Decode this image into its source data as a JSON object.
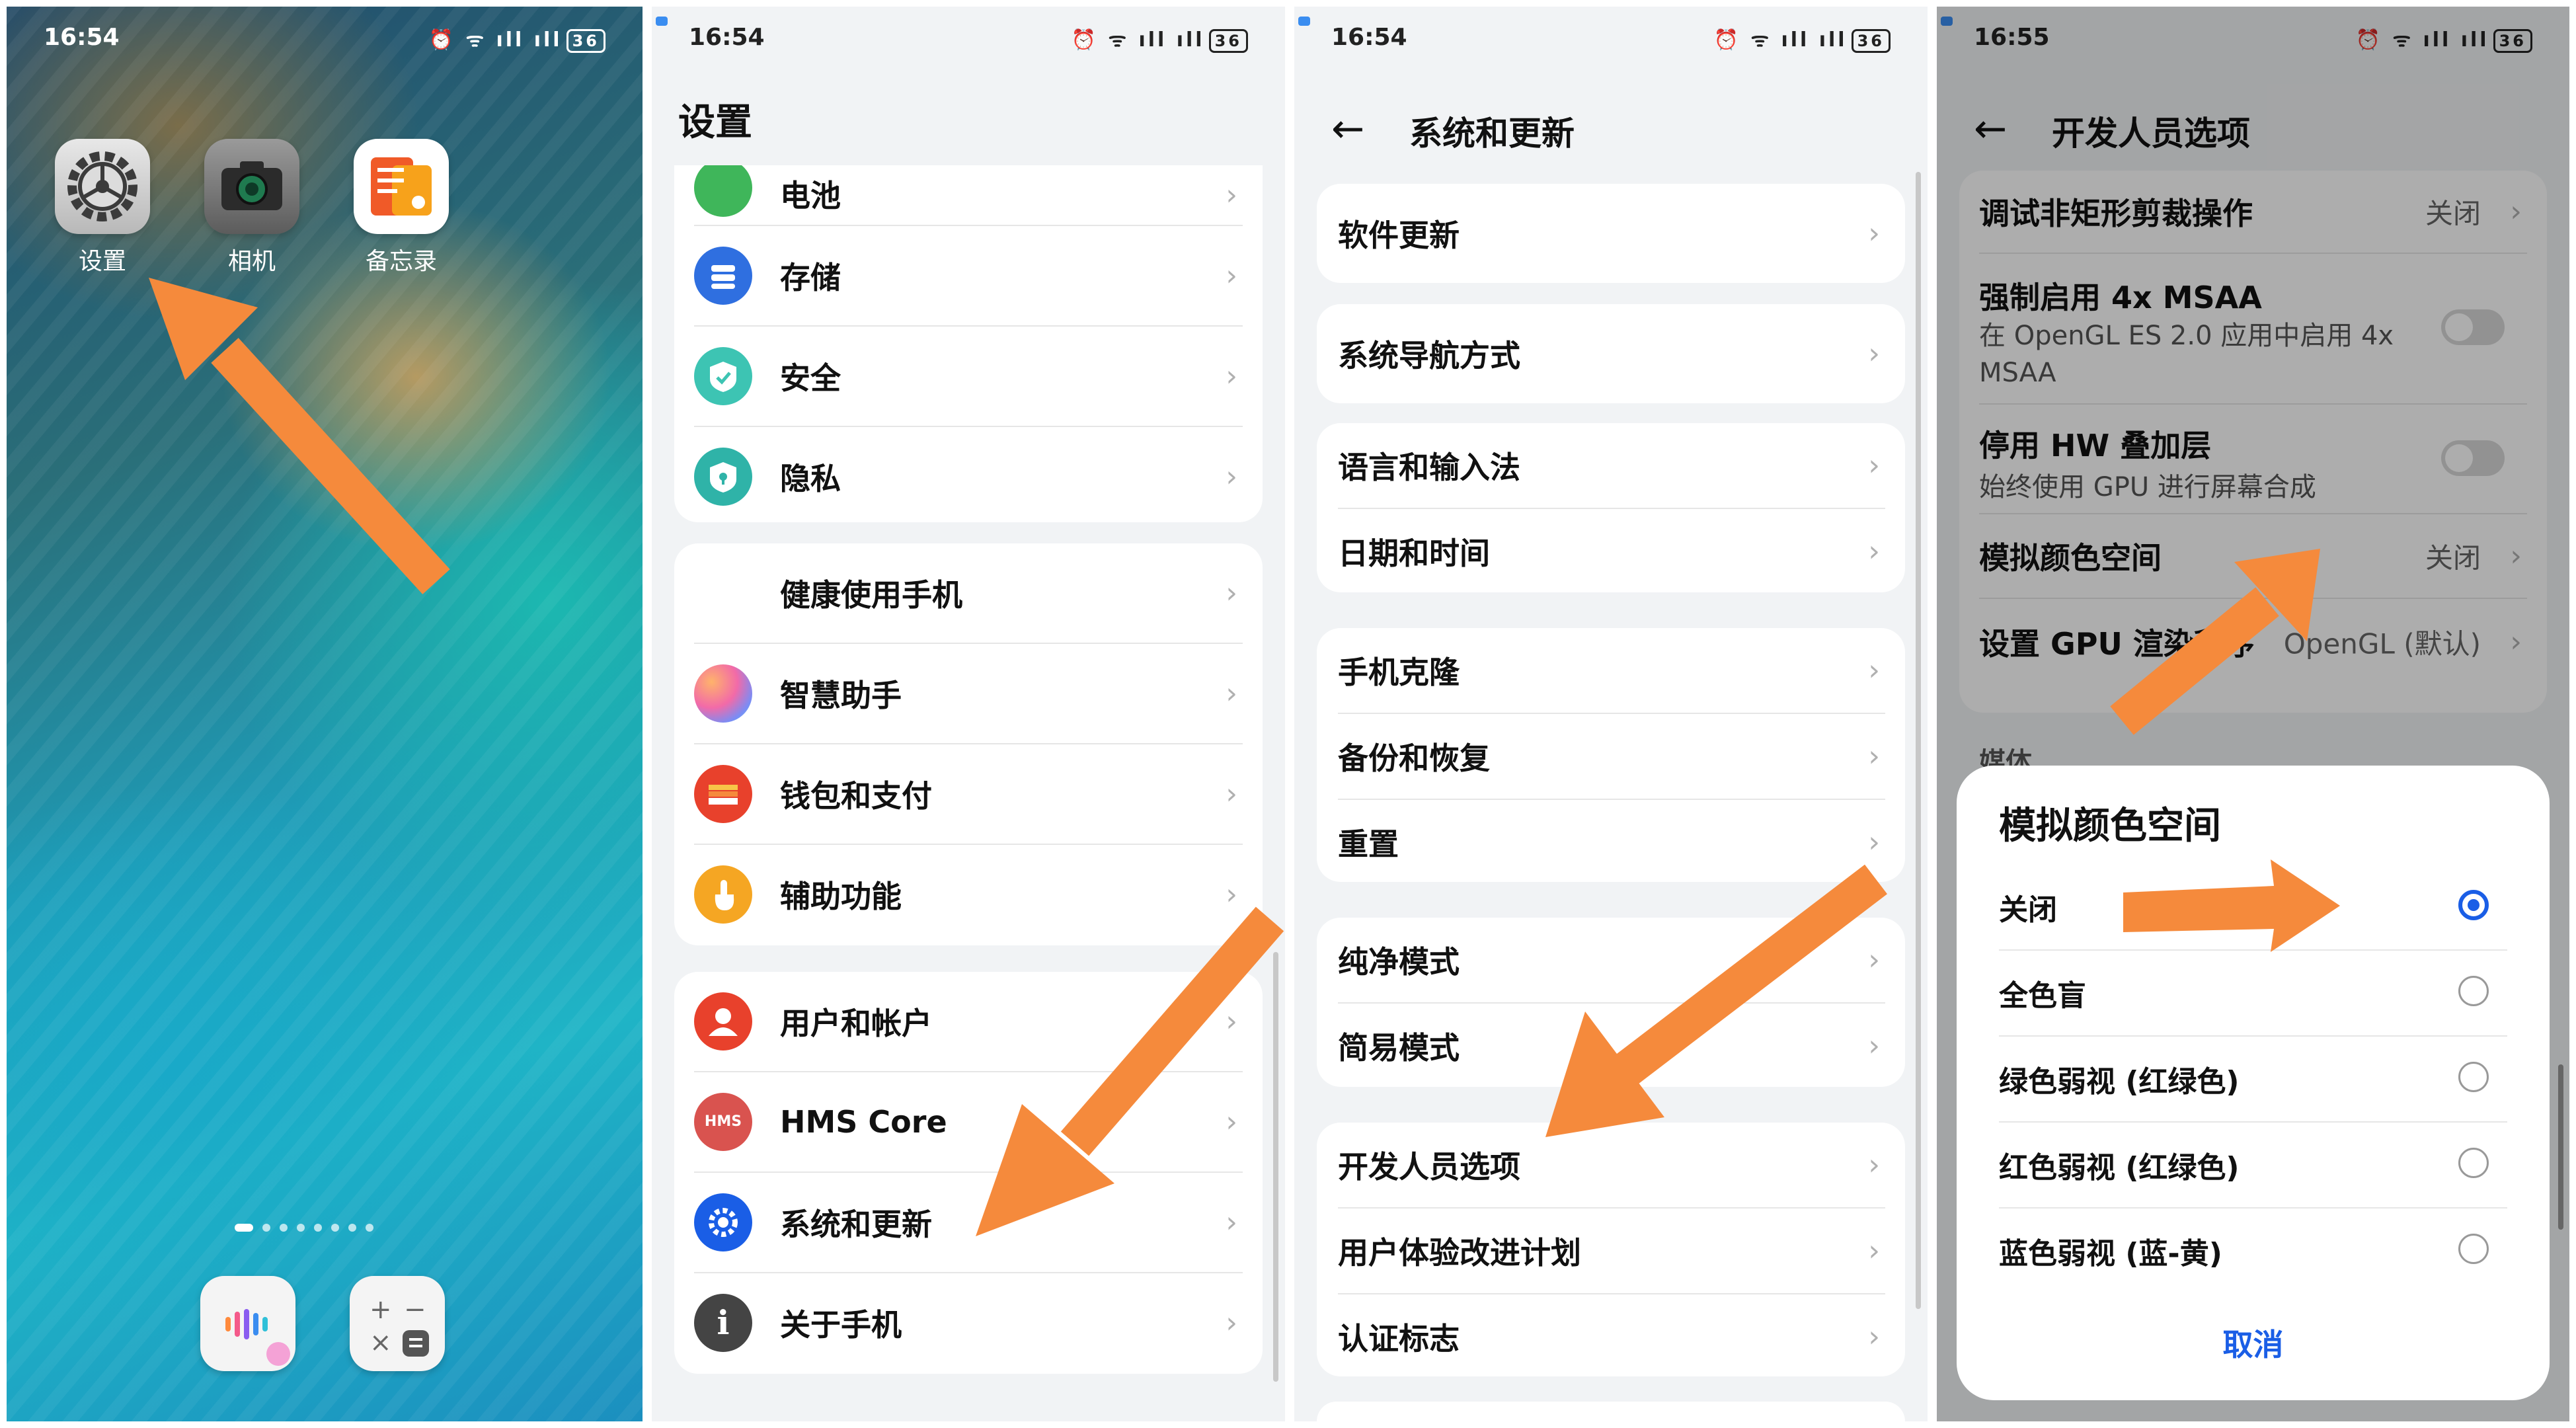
{
  "p1": {
    "time": "16:54",
    "status_icons": "⏰ ᯤ ıll ıll",
    "battery": "36",
    "apps": [
      {
        "label": "设置",
        "icon": "settings-gear-icon"
      },
      {
        "label": "相机",
        "icon": "camera-icon"
      },
      {
        "label": "备忘录",
        "icon": "notes-icon"
      }
    ],
    "dock": [
      {
        "icon": "voice-assistant-icon"
      },
      {
        "icon": "calculator-icon",
        "glyph": "+ −\n× ="
      }
    ]
  },
  "p2": {
    "time": "16:54",
    "status_icons": "⏰ ᯤ ıll ıll",
    "battery": "36",
    "title": "设置",
    "partial_item": "电池",
    "group1": [
      "存储",
      "安全",
      "隐私"
    ],
    "group2": [
      "健康使用手机",
      "智慧助手",
      "钱包和支付",
      "辅助功能"
    ],
    "group3": [
      "用户和帐户",
      "HMS Core",
      "系统和更新",
      "关于手机"
    ],
    "icon_glyphs": {
      "hms": "HMS",
      "about": "i"
    },
    "icon_colors": [
      "#2f6fe0",
      "#1fb6a6",
      "#27b0a0",
      "#2ab34a",
      "#ff8a5c",
      "#e8412c",
      "#f5a623",
      "#e8412c",
      "#d9534f",
      "#1a5ee6",
      "#444444"
    ]
  },
  "p3": {
    "time": "16:54",
    "status_icons": "⏰ ᯤ ıll ıll",
    "battery": "36",
    "title": "系统和更新",
    "items": [
      "软件更新",
      "系统导航方式",
      "语言和输入法",
      "日期和时间",
      "手机克隆",
      "备份和恢复",
      "重置",
      "纯净模式",
      "简易模式",
      "开发人员选项",
      "用户体验改进计划",
      "认证标志"
    ]
  },
  "p4": {
    "time": "16:55",
    "status_icons": "⏰ ᯤ ıll ıll",
    "battery": "36",
    "title": "开发人员选项",
    "settings": {
      "debug_clip": {
        "label": "调试非矩形剪裁操作",
        "value": "关闭"
      },
      "msaa": {
        "label": "强制启用 4x MSAA",
        "sub": "在 OpenGL ES 2.0 应用中启用 4x MSAA"
      },
      "hw_overlay": {
        "label": "停用 HW 叠加层",
        "sub": "始终使用 GPU 进行屏幕合成"
      },
      "color_space": {
        "label": "模拟颜色空间",
        "value": "关闭"
      },
      "gpu_renderer": {
        "label": "设置 GPU 渲染程序",
        "value": "OpenGL (默认)"
      },
      "section_media": "媒体"
    },
    "dialog": {
      "title": "模拟颜色空间",
      "options": [
        "关闭",
        "全色盲",
        "绿色弱视 (红绿色)",
        "红色弱视 (红绿色)",
        "蓝色弱视 (蓝-黄)"
      ],
      "selected": 0,
      "cancel": "取消"
    }
  },
  "colors": {
    "arrow": "#f58a3c",
    "accent": "#1a5ee6"
  }
}
